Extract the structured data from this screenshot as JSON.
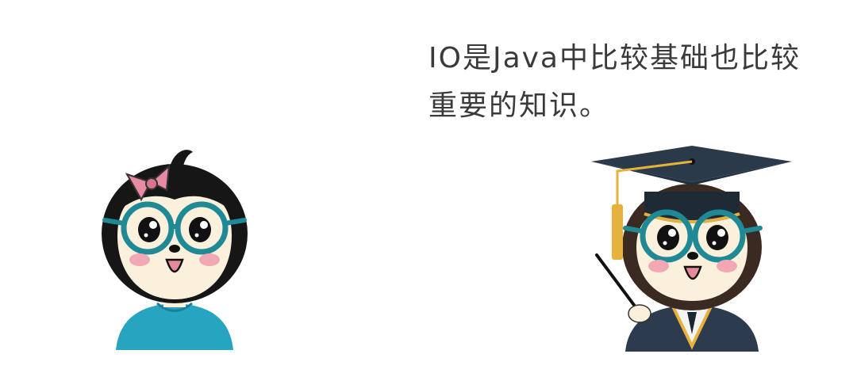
{
  "speech": {
    "line1": "IO是Java中比较基础也比较",
    "line2": "重要的知识。"
  },
  "characters": [
    {
      "name": "girl-character",
      "accessories": [
        "pink-bow",
        "teal-glasses",
        "blue-shirt"
      ]
    },
    {
      "name": "teacher-character",
      "accessories": [
        "graduation-cap",
        "tassel",
        "teal-glasses",
        "gown",
        "pointer-stick"
      ]
    }
  ],
  "colors": {
    "text": "#3a3a3a",
    "hair": "#1a1a1a",
    "teacher_hair": "#3b2a22",
    "skin": "#fbf0dc",
    "glasses": "#1f8a95",
    "bow": "#e98aa3",
    "shirt": "#27a4c0",
    "cap": "#2b3a4a",
    "tassel": "#e6b13c",
    "gown": "#2c3b4d",
    "blush": "#f2a7b4"
  }
}
